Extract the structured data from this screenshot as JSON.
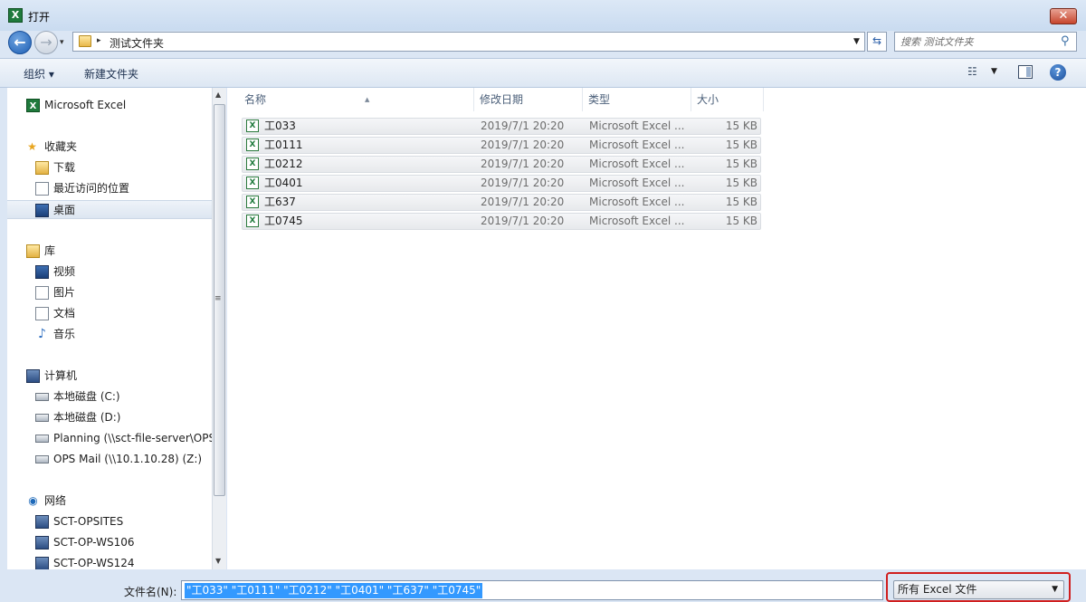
{
  "window": {
    "title": "打开",
    "app_icon": "excel-icon"
  },
  "address": {
    "path": "测试文件夹"
  },
  "search": {
    "placeholder": "搜索 测试文件夹"
  },
  "toolbar": {
    "organize": "组织 ▾",
    "new_folder": "新建文件夹"
  },
  "sidebar": {
    "top_item": "Microsoft Excel",
    "favorites": {
      "header": "收藏夹",
      "items": [
        "下载",
        "最近访问的位置",
        "桌面"
      ],
      "selected": "桌面"
    },
    "libraries": {
      "header": "库",
      "items": [
        "视频",
        "图片",
        "文档",
        "音乐"
      ]
    },
    "computer": {
      "header": "计算机",
      "items": [
        "本地磁盘 (C:)",
        "本地磁盘 (D:)",
        "Planning (\\\\sct-file-server\\OPS",
        "OPS Mail (\\\\10.1.10.28) (Z:)"
      ]
    },
    "network": {
      "header": "网络",
      "items": [
        "SCT-OPSITES",
        "SCT-OP-WS106",
        "SCT-OP-WS124"
      ]
    }
  },
  "columns": {
    "name": "名称",
    "date": "修改日期",
    "type": "类型",
    "size": "大小"
  },
  "files": [
    {
      "name": "工033",
      "date": "2019/7/1 20:20",
      "type": "Microsoft Excel ...",
      "size": "15 KB"
    },
    {
      "name": "工0111",
      "date": "2019/7/1 20:20",
      "type": "Microsoft Excel ...",
      "size": "15 KB"
    },
    {
      "name": "工0212",
      "date": "2019/7/1 20:20",
      "type": "Microsoft Excel ...",
      "size": "15 KB"
    },
    {
      "name": "工0401",
      "date": "2019/7/1 20:20",
      "type": "Microsoft Excel ...",
      "size": "15 KB"
    },
    {
      "name": "工637",
      "date": "2019/7/1 20:20",
      "type": "Microsoft Excel ...",
      "size": "15 KB"
    },
    {
      "name": "工0745",
      "date": "2019/7/1 20:20",
      "type": "Microsoft Excel ...",
      "size": "15 KB"
    }
  ],
  "bottom": {
    "filename_label": "文件名(N):",
    "filename_value": "\"工033\" \"工0111\" \"工0212\" \"工0401\" \"工637\" \"工0745\"",
    "filetype": "所有 Excel 文件"
  },
  "colors": {
    "highlight_outline": "#d01f1f",
    "selection": "#3399ff"
  }
}
